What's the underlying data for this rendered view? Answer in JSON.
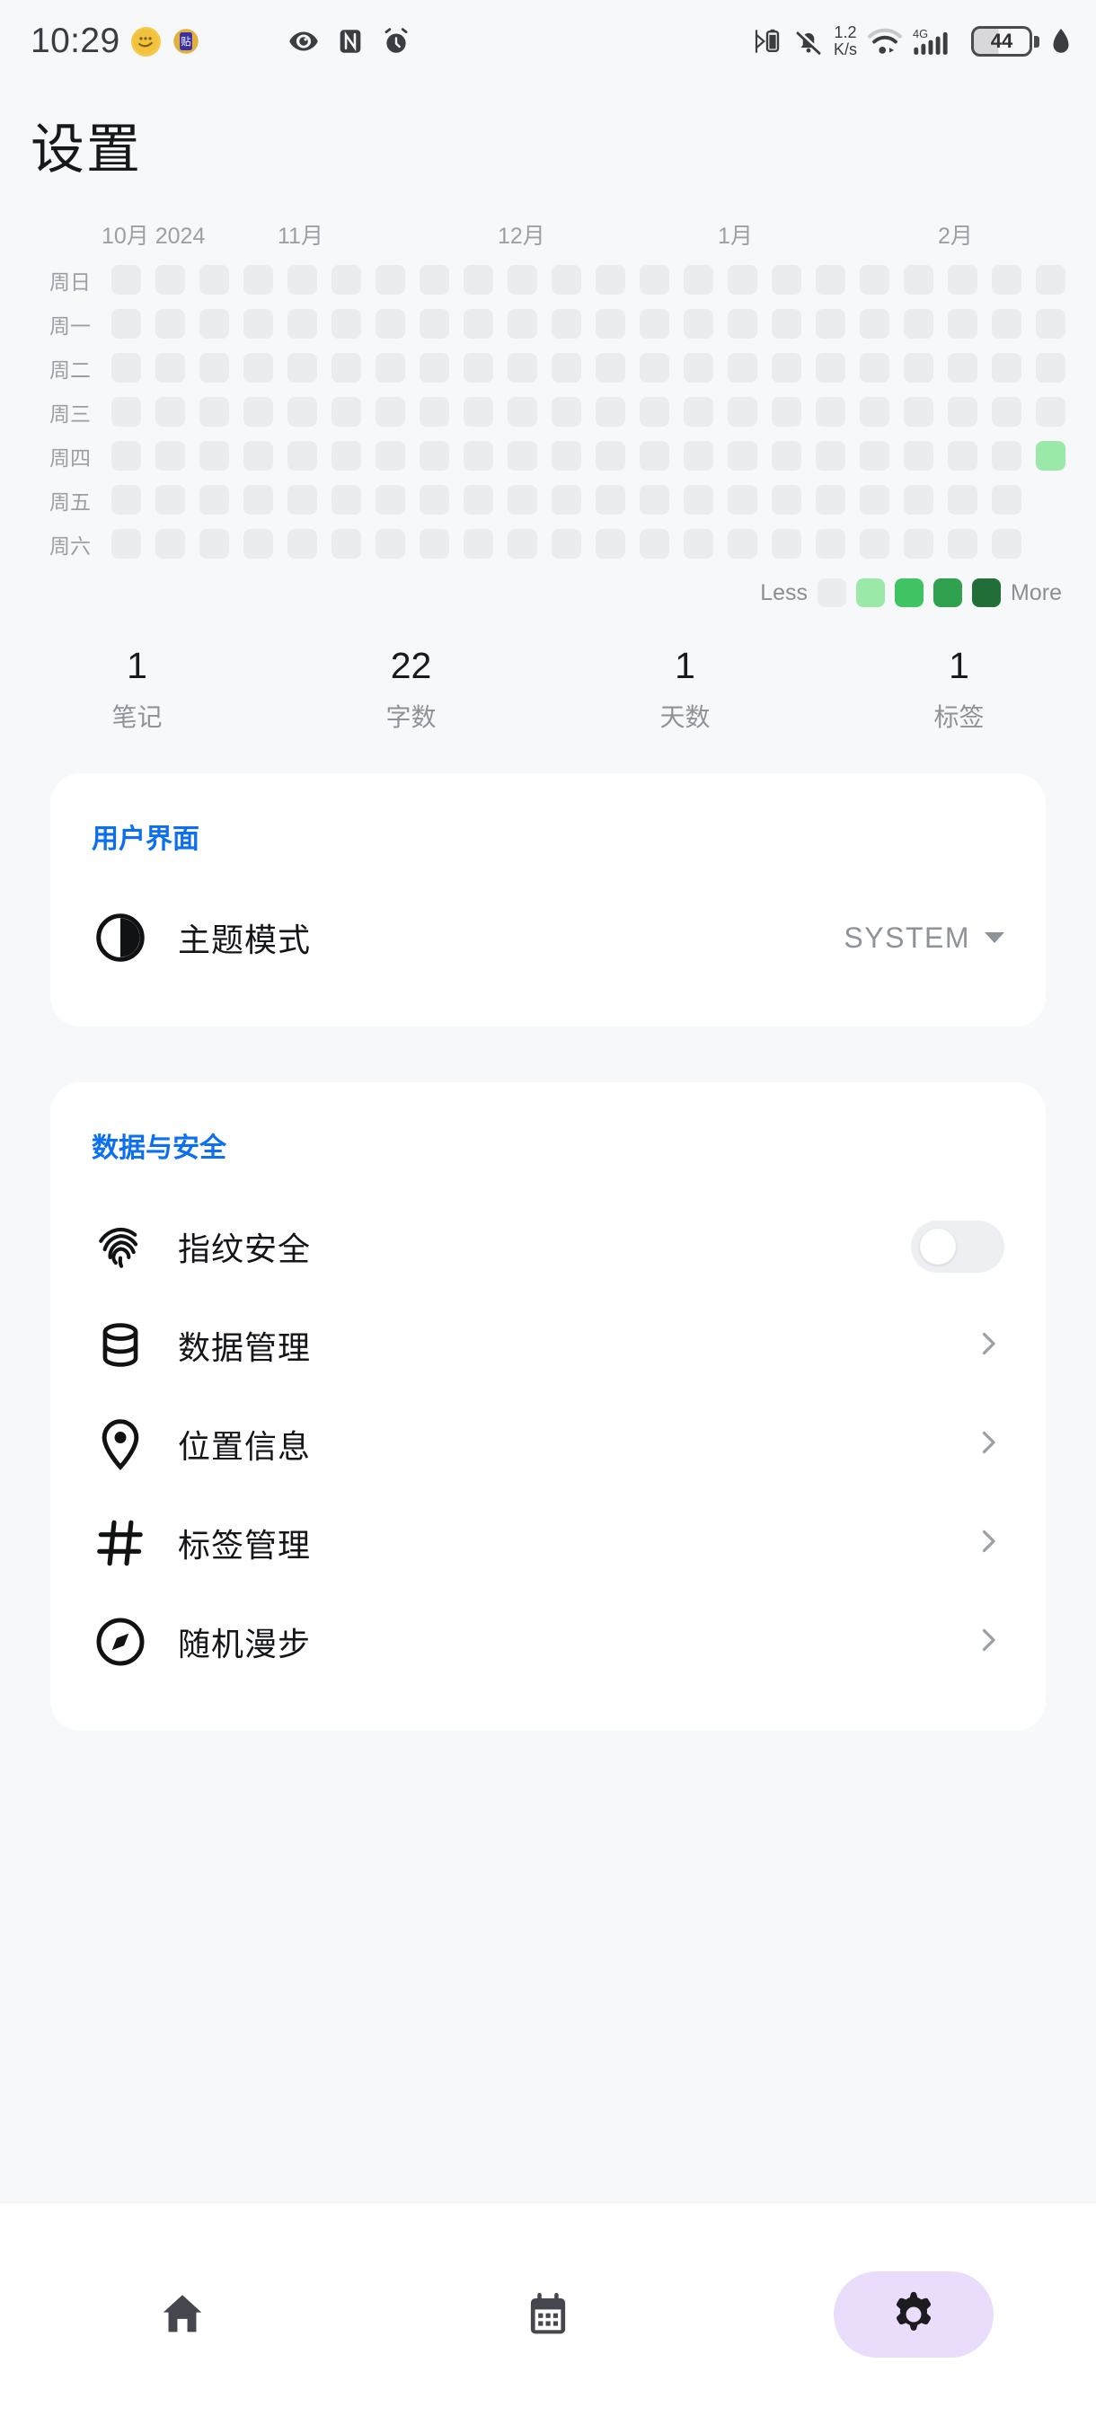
{
  "status_bar": {
    "time": "10:29",
    "left_badges": [
      {
        "name": "emoji-notification-icon",
        "glyph": "···"
      },
      {
        "name": "tieba-notification-icon",
        "glyph": "贴"
      }
    ],
    "mid_icons": [
      "eye-icon",
      "nfc-icon",
      "alarm-icon"
    ],
    "right_icons": [
      "bluetooth-battery-icon",
      "mute-bell-icon"
    ],
    "network_speed_value": "1.2",
    "network_speed_unit": "K/s",
    "wifi_icon": "wifi-icon",
    "mobile_network_label": "4G",
    "signal_icon": "signal-bars-icon",
    "battery_percent": "44",
    "eco_icon": "leaf-icon"
  },
  "header": {
    "title": "设置"
  },
  "heatmap": {
    "months": [
      {
        "label": "10月 2024",
        "col": 0
      },
      {
        "label": "11月",
        "col": 4
      },
      {
        "label": "12月",
        "col": 9
      },
      {
        "label": "1月",
        "col": 14
      },
      {
        "label": "2月",
        "col": 19
      }
    ],
    "weekdays": [
      "周日",
      "周一",
      "周二",
      "周三",
      "周四",
      "周五",
      "周六"
    ],
    "legend": {
      "less_label": "Less",
      "more_label": "More",
      "colors": [
        "#EAECF0",
        "#9BE9A8",
        "#40C463",
        "#30A14E",
        "#216E39"
      ]
    },
    "columns": 23,
    "rows": 7,
    "empty_cells": [
      [
        22,
        5
      ],
      [
        22,
        6
      ]
    ],
    "active_cells": [
      {
        "col": 22,
        "row": 4,
        "level": 1
      }
    ],
    "base_color": "#EAECF0"
  },
  "stats": [
    {
      "value": "1",
      "label": "笔记"
    },
    {
      "value": "22",
      "label": "字数"
    },
    {
      "value": "1",
      "label": "天数"
    },
    {
      "value": "1",
      "label": "标签"
    }
  ],
  "sections": [
    {
      "title": "用户界面",
      "rows": [
        {
          "icon": "theme-contrast-icon",
          "label": "主题模式",
          "control": "dropdown",
          "value": "SYSTEM"
        }
      ]
    },
    {
      "title": "数据与安全",
      "rows": [
        {
          "icon": "fingerprint-icon",
          "label": "指纹安全",
          "control": "toggle",
          "value": "off"
        },
        {
          "icon": "database-icon",
          "label": "数据管理",
          "control": "chevron"
        },
        {
          "icon": "location-pin-icon",
          "label": "位置信息",
          "control": "chevron"
        },
        {
          "icon": "hash-icon",
          "label": "标签管理",
          "control": "chevron"
        },
        {
          "icon": "compass-icon",
          "label": "随机漫步",
          "control": "chevron"
        }
      ]
    }
  ],
  "bottom_nav": {
    "items": [
      {
        "icon": "home-icon",
        "active": false
      },
      {
        "icon": "calendar-icon",
        "active": false
      },
      {
        "icon": "gear-icon",
        "active": true
      }
    ],
    "active_pill_color": "#EADDFB"
  },
  "theme": {
    "accent_blue": "#0B6FF0",
    "page_background": "#F7F8FA",
    "card_background": "#FFFFFF"
  }
}
